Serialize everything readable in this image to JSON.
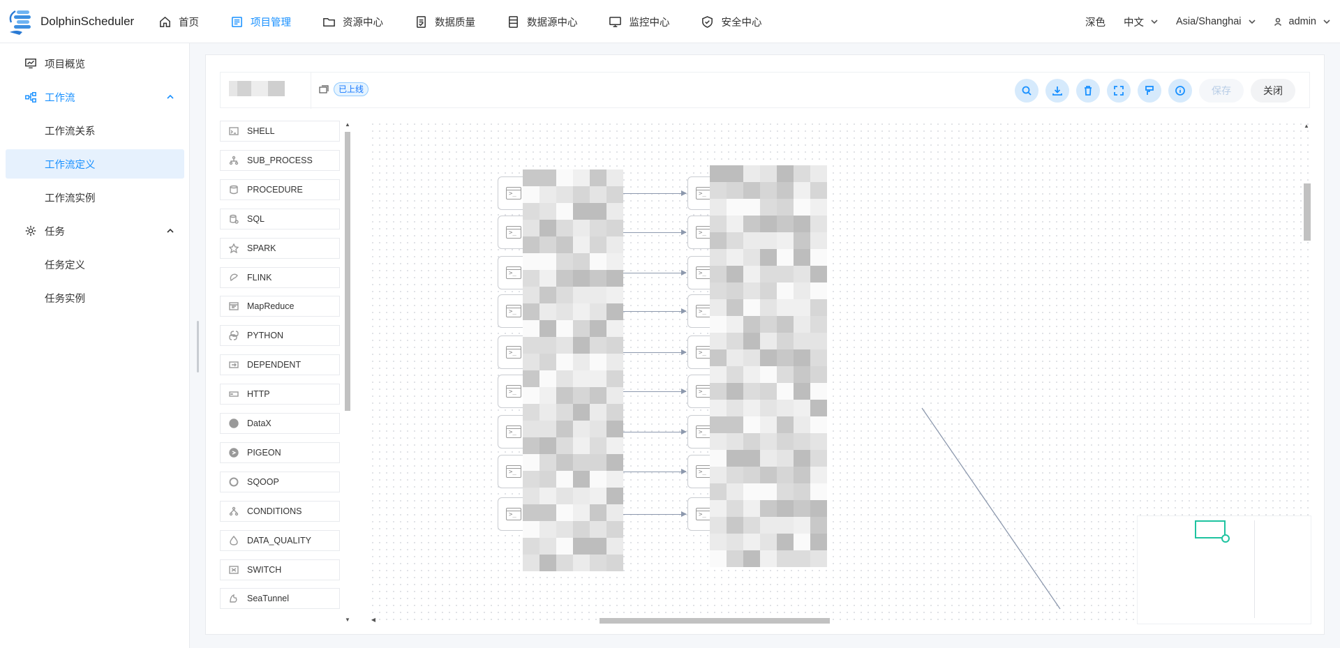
{
  "app": {
    "name": "DolphinScheduler"
  },
  "header": {
    "nav": [
      {
        "label": "首页",
        "icon": "home-icon",
        "active": false
      },
      {
        "label": "项目管理",
        "icon": "project-icon",
        "active": true
      },
      {
        "label": "资源中心",
        "icon": "folder-icon",
        "active": false
      },
      {
        "label": "数据质量",
        "icon": "data-quality-icon",
        "active": false
      },
      {
        "label": "数据源中心",
        "icon": "datasource-icon",
        "active": false
      },
      {
        "label": "监控中心",
        "icon": "monitor-icon",
        "active": false
      },
      {
        "label": "安全中心",
        "icon": "shield-icon",
        "active": false
      }
    ],
    "theme": "深色",
    "language": "中文",
    "timezone": "Asia/Shanghai",
    "user": "admin"
  },
  "sidebar": {
    "items": [
      {
        "label": "项目概览",
        "icon": "overview-icon",
        "level": 1
      },
      {
        "label": "工作流",
        "icon": "workflow-icon",
        "level": 1,
        "expanded": true
      },
      {
        "label": "工作流关系",
        "level": 2
      },
      {
        "label": "工作流定义",
        "level": 2,
        "selected": true
      },
      {
        "label": "工作流实例",
        "level": 2
      },
      {
        "label": "任务",
        "icon": "gear-icon",
        "level": 1,
        "expanded": true
      },
      {
        "label": "任务定义",
        "level": 2
      },
      {
        "label": "任务实例",
        "level": 2
      }
    ]
  },
  "toolbar": {
    "status": "已上线",
    "buttons": [
      "search-icon",
      "download-icon",
      "trash-icon",
      "fullscreen-icon",
      "format-icon",
      "info-icon"
    ],
    "save_label": "保存",
    "close_label": "关闭"
  },
  "palette": {
    "items": [
      "SHELL",
      "SUB_PROCESS",
      "PROCEDURE",
      "SQL",
      "SPARK",
      "FLINK",
      "MapReduce",
      "PYTHON",
      "DEPENDENT",
      "HTTP",
      "DataX",
      "PIGEON",
      "SQOOP",
      "CONDITIONS",
      "DATA_QUALITY",
      "SWITCH",
      "SeaTunnel"
    ]
  },
  "colors": {
    "accent": "#1890ff",
    "selected_bg": "#e6f1fd",
    "edge": "#8c98ad",
    "minimap": "#1ec3a0"
  }
}
